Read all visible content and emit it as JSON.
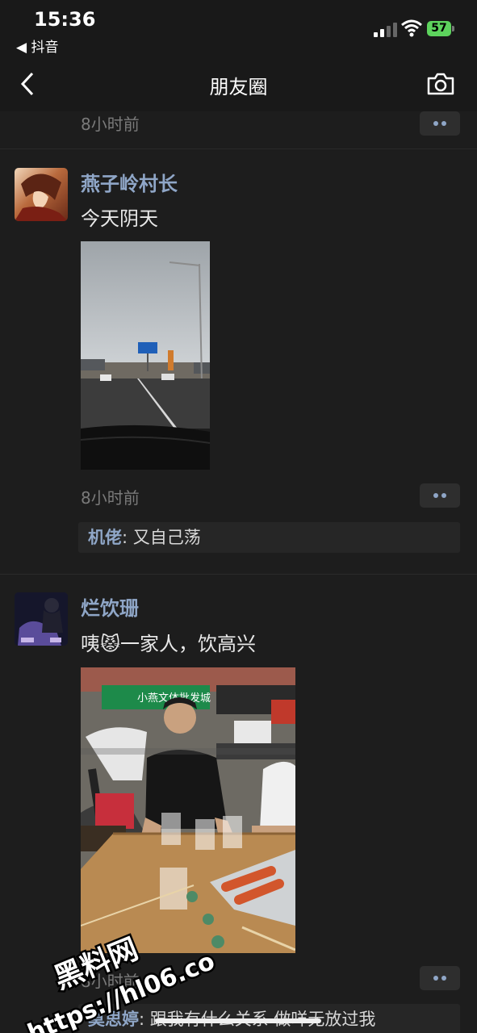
{
  "status_bar": {
    "time": "15:36",
    "back_app": "◀ 抖音",
    "battery": "57"
  },
  "nav": {
    "title": "朋友圈"
  },
  "posts": [
    {
      "time": "8小时前"
    },
    {
      "author": "燕子岭村长",
      "text": "今天阴天",
      "time": "8小时前",
      "comment": {
        "author": "机佬",
        "text": ": 又自己荡"
      }
    },
    {
      "author": "烂饮珊",
      "text_before": "咦",
      "emoji": "😾",
      "text_after": "一家人，饮高兴",
      "photo_sign": "小燕文体批发城",
      "time": "8小时前",
      "comment": {
        "author": "莫思婷",
        "text": ": 跟我有什么关系 做咩无放过我"
      }
    }
  ],
  "watermark": {
    "line1": "黑料网",
    "line2": "https://hl06.co"
  },
  "colors": {
    "link": "#8fa6c7",
    "background": "#191919",
    "battery": "#5dd35d"
  }
}
